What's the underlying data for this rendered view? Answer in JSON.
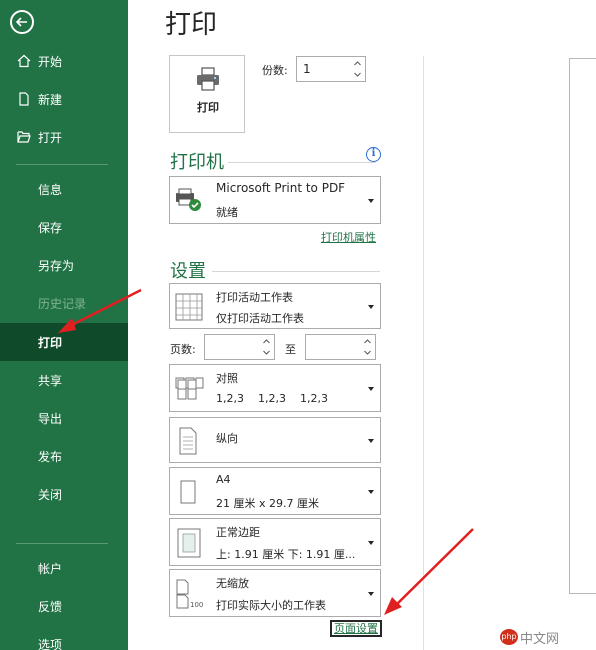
{
  "sidebar": {
    "items": [
      {
        "label": "开始",
        "icon": "home-icon"
      },
      {
        "label": "新建",
        "icon": "new-doc-icon"
      },
      {
        "label": "打开",
        "icon": "folder-open-icon"
      },
      {
        "label": "信息"
      },
      {
        "label": "保存"
      },
      {
        "label": "另存为"
      },
      {
        "label": "历史记录",
        "disabled": true
      },
      {
        "label": "打印",
        "active": true
      },
      {
        "label": "共享"
      },
      {
        "label": "导出"
      },
      {
        "label": "发布"
      },
      {
        "label": "关闭"
      },
      {
        "label": "帐户"
      },
      {
        "label": "反馈"
      },
      {
        "label": "选项"
      }
    ]
  },
  "main": {
    "title": "打印",
    "print_button": "打印",
    "copies": {
      "label": "份数:",
      "value": "1"
    },
    "printer": {
      "heading": "打印机",
      "name": "Microsoft Print to PDF",
      "status": "就绪",
      "properties_link": "打印机属性"
    },
    "settings": {
      "heading": "设置",
      "what": {
        "line1": "打印活动工作表",
        "line2": "仅打印活动工作表"
      },
      "pages": {
        "label": "页数:",
        "to": "至",
        "from_value": "",
        "to_value": ""
      },
      "collate": {
        "line1": "对照",
        "line2": "1,2,3    1,2,3    1,2,3"
      },
      "orientation": {
        "line1": "纵向"
      },
      "paper": {
        "line1": "A4",
        "line2": "21 厘米 x 29.7 厘米"
      },
      "margins": {
        "line1": "正常边距",
        "line2": "上: 1.91 厘米 下: 1.91 厘..."
      },
      "scaling": {
        "line1": "无缩放",
        "line2": "打印实际大小的工作表"
      },
      "page_setup_link": "页面设置"
    }
  },
  "watermark": {
    "logo": "php",
    "text": "中文网"
  },
  "colors": {
    "sidebar": "#217346",
    "active": "#0f4b2a",
    "accent": "#217346",
    "annotation": "#e02020"
  }
}
